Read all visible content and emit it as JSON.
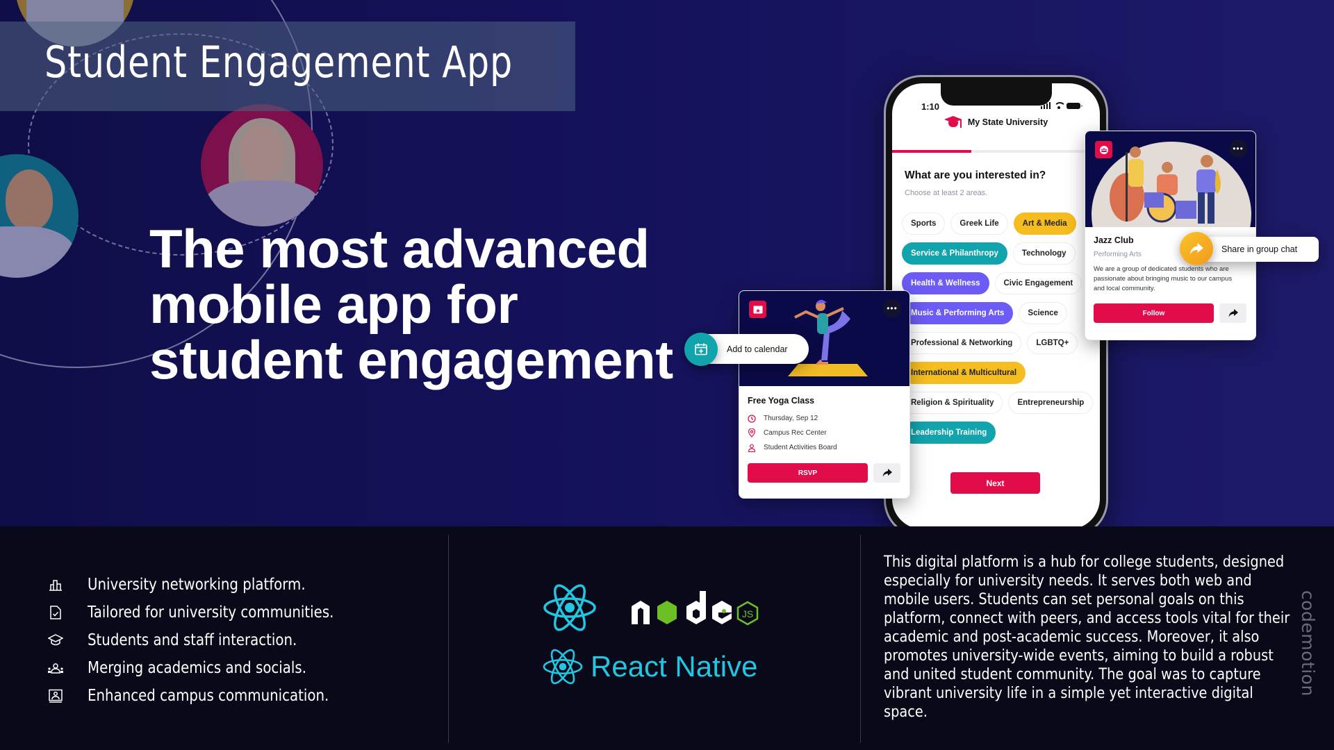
{
  "page": {
    "title": "Student Engagement App",
    "headline": "The most advanced mobile app for student engagement",
    "brand": "codemotion"
  },
  "colors": {
    "accent_red": "#e30c4a",
    "accent_teal": "#12a4ad",
    "accent_purple": "#6c5cf5",
    "accent_yellow": "#f5bd1f",
    "hero_bg": "#14115a",
    "bottom_bg": "#09091a",
    "react_cyan": "#21c6e0",
    "node_green": "#6cc024"
  },
  "phone": {
    "status_time": "1:10",
    "university_name": "My State University",
    "onboarding_progress": 0.38,
    "question_title": "What are you interested in?",
    "question_subtitle": "Choose at least 2 areas.",
    "chips": [
      {
        "label": "Sports",
        "selected": false,
        "color": "none"
      },
      {
        "label": "Greek Life",
        "selected": false,
        "color": "none"
      },
      {
        "label": "Art & Media",
        "selected": true,
        "color": "yellow"
      },
      {
        "label": "Service & Philanthropy",
        "selected": true,
        "color": "teal"
      },
      {
        "label": "Technology",
        "selected": false,
        "color": "none"
      },
      {
        "label": "Health & Wellness",
        "selected": true,
        "color": "purple"
      },
      {
        "label": "Civic Engagement",
        "selected": false,
        "color": "none"
      },
      {
        "label": "Music & Performing Arts",
        "selected": true,
        "color": "purple"
      },
      {
        "label": "Science",
        "selected": false,
        "color": "none"
      },
      {
        "label": "Professional & Networking",
        "selected": false,
        "color": "none"
      },
      {
        "label": "LGBTQ+",
        "selected": false,
        "color": "none"
      },
      {
        "label": "International & Multicultural",
        "selected": true,
        "color": "yellow"
      },
      {
        "label": "Religion & Spirituality",
        "selected": false,
        "color": "none"
      },
      {
        "label": "Entrepreneurship",
        "selected": false,
        "color": "none"
      },
      {
        "label": "Leadership Training",
        "selected": true,
        "color": "teal"
      }
    ],
    "next_label": "Next"
  },
  "event_card": {
    "title": "Free Yoga Class",
    "date": "Thursday, Sep 12",
    "location": "Campus Rec Center",
    "organizer": "Student Activities Board",
    "rsvp_label": "RSVP",
    "more_label": "•••",
    "callout_label": "Add to calendar"
  },
  "club_card": {
    "title": "Jazz Club",
    "category": "Performing Arts",
    "description": "We are a group of dedicated students who are passionate about bringing music to our campus and local community.",
    "follow_label": "Follow",
    "more_label": "•••",
    "callout_label": "Share in group chat"
  },
  "features": [
    {
      "icon": "building-chart-icon",
      "label": "University networking platform."
    },
    {
      "icon": "document-check-icon",
      "label": "Tailored for university communities."
    },
    {
      "icon": "graduation-cap-icon",
      "label": "Students and staff interaction."
    },
    {
      "icon": "people-group-icon",
      "label": "Merging academics and socials."
    },
    {
      "icon": "presentation-user-icon",
      "label": "Enhanced campus communication."
    }
  ],
  "tech_stack": {
    "logos": [
      "React",
      "node.js",
      "React Native"
    ],
    "node_word": "node",
    "node_js": "JS",
    "react_native_label": "React Native"
  },
  "description": "This digital platform is a hub for college students, designed especially for university needs. It serves both web and mobile users. Students can set personal goals on this platform, connect with peers, and access tools vital for their academic and post-academic success. Moreover, it also promotes university-wide events, aiming to build a robust and united student community. The goal was to capture vibrant university life in a simple yet interactive digital space."
}
